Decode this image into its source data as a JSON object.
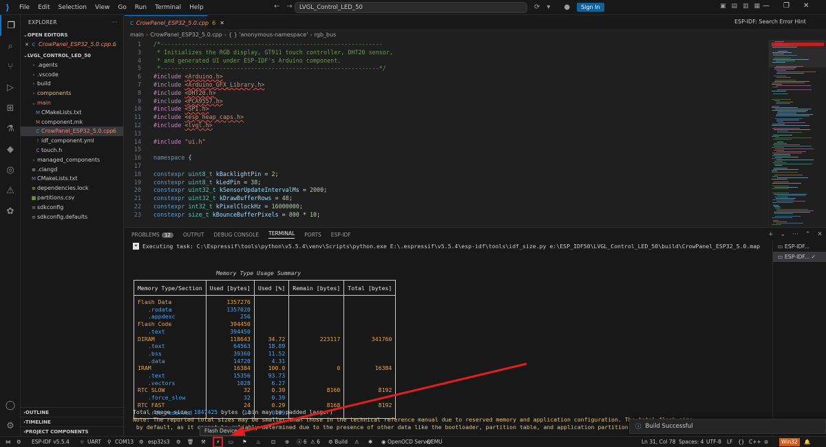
{
  "app": {
    "menu": [
      "File",
      "Edit",
      "Selection",
      "View",
      "Go",
      "Run",
      "Terminal",
      "Help"
    ],
    "search_text": "LVGL_Control_LED_50",
    "sign_in": "Sign In"
  },
  "sidebar": {
    "title": "EXPLORER",
    "open_editors_label": "OPEN EDITORS",
    "open_editor_file": "CrowPanel_ESP32_5.0.cpp...",
    "open_editor_badge": "6",
    "project_label": "LVGL_CONTROL_LED_50",
    "tree": [
      {
        "label": ".agents",
        "kind": "folder"
      },
      {
        "label": ".vscode",
        "kind": "folder"
      },
      {
        "label": "build",
        "kind": "folder"
      },
      {
        "label": "components",
        "kind": "folder"
      },
      {
        "label": "main",
        "kind": "folder-open"
      },
      {
        "label": "CMakeLists.txt",
        "kind": "file"
      },
      {
        "label": "component.mk",
        "kind": "file"
      },
      {
        "label": "CrowPanel_ESP32_5.0.cpp",
        "kind": "file",
        "badge": "6"
      },
      {
        "label": "idf_component.yml",
        "kind": "file"
      },
      {
        "label": "touch.h",
        "kind": "file"
      },
      {
        "label": "managed_components",
        "kind": "folder"
      },
      {
        "label": ".clangd",
        "kind": "file"
      },
      {
        "label": "CMakeLists.txt",
        "kind": "file"
      },
      {
        "label": "dependencies.lock",
        "kind": "file"
      },
      {
        "label": "partitions.csv",
        "kind": "file"
      },
      {
        "label": "sdkconfig",
        "kind": "file"
      },
      {
        "label": "sdkconfig.defaults",
        "kind": "file"
      }
    ],
    "bottom_sections": [
      "OUTLINE",
      "TIMELINE",
      "PROJECT COMPONENTS"
    ]
  },
  "editor": {
    "tab_label": "CrowPanel_ESP32_5.0.cpp",
    "tab_badge": "6",
    "hint": "ESP-IDF: Search Error Hint",
    "breadcrumb": [
      "main",
      "CrowPanel_ESP32_5.0.cpp",
      "{ } 'anonymous-namespace'",
      "rgb_bus"
    ],
    "lines": [
      {
        "n": "1",
        "t": "/*----------------------------------------------------------------"
      },
      {
        "n": "3",
        "t": " * Initializes the RGB display, GT911 touch controller, DHT20 sensor,"
      },
      {
        "n": "4",
        "t": " * and generated UI under ESP-IDF's Arduino component."
      },
      {
        "n": "5",
        "t": " *---------------------------------------------------------------*/"
      },
      {
        "n": "6",
        "t": "#include <Arduino.h>"
      },
      {
        "n": "7",
        "t": "#include <Arduino_GFX_Library.h>"
      },
      {
        "n": "8",
        "t": "#include <DHT20.h>"
      },
      {
        "n": "9",
        "t": "#include <PCA9557.h>"
      },
      {
        "n": "10",
        "t": "#include <SPI.h>"
      },
      {
        "n": "11",
        "t": "#include <esp_heap_caps.h>"
      },
      {
        "n": "12",
        "t": "#include <lvgl.h>"
      },
      {
        "n": "13",
        "t": ""
      },
      {
        "n": "14",
        "t": "#include \"ui.h\""
      },
      {
        "n": "15",
        "t": ""
      },
      {
        "n": "16",
        "t": "namespace {"
      },
      {
        "n": "17",
        "t": ""
      },
      {
        "n": "18",
        "t": "constexpr uint8_t kBacklightPin = 2;"
      },
      {
        "n": "19",
        "t": "constexpr uint8_t kLedPin = 38;"
      },
      {
        "n": "20",
        "t": "constexpr uint32_t kSensorUpdateIntervalMs = 2000;"
      },
      {
        "n": "21",
        "t": "constexpr uint32_t kDrawBufferRows = 48;"
      },
      {
        "n": "22",
        "t": "constexpr int32_t kPixelClockHz = 16000000;"
      },
      {
        "n": "23",
        "t": "constexpr size_t kBounceBufferPixels = 800 * 10;"
      }
    ]
  },
  "panel": {
    "tabs": [
      "PROBLEMS",
      "OUTPUT",
      "DEBUG CONSOLE",
      "TERMINAL",
      "PORTS",
      "ESP-IDF"
    ],
    "problems_count": "12",
    "task_line": "Executing task: C:\\Espressif\\tools\\python\\v5.5.4\\venv\\Scripts\\python.exe E:\\.espressif\\v5.5.4\\esp-idf\\tools\\idf_size.py e:\\ESP_IDF50\\LVGL_Control_LED_50\\build\\CrowPanel_ESP32_5.0.map",
    "table_title": "Memory Type Usage Summary",
    "table_headers": [
      "Memory Type/Section",
      "Used [bytes]",
      "Used [%]",
      "Remain [bytes]",
      "Total [bytes]"
    ],
    "table_rows": [
      {
        "name": "Flash Data",
        "used": "1357276",
        "pct": "",
        "remain": "",
        "total": "",
        "sub": false
      },
      {
        "name": ".rodata",
        "used": "1357020",
        "pct": "",
        "remain": "",
        "total": "",
        "sub": true
      },
      {
        "name": ".appdesc",
        "used": "256",
        "pct": "",
        "remain": "",
        "total": "",
        "sub": true
      },
      {
        "name": "Flash Code",
        "used": "394450",
        "pct": "",
        "remain": "",
        "total": "",
        "sub": false
      },
      {
        "name": ".text",
        "used": "394450",
        "pct": "",
        "remain": "",
        "total": "",
        "sub": true
      },
      {
        "name": "DIRAM",
        "used": "118643",
        "pct": "34.72",
        "remain": "223117",
        "total": "341760",
        "sub": false
      },
      {
        "name": ".text",
        "used": "64563",
        "pct": "18.89",
        "remain": "",
        "total": "",
        "sub": true
      },
      {
        "name": ".bss",
        "used": "39360",
        "pct": "11.52",
        "remain": "",
        "total": "",
        "sub": true
      },
      {
        "name": ".data",
        "used": "14720",
        "pct": "4.31",
        "remain": "",
        "total": "",
        "sub": true
      },
      {
        "name": "IRAM",
        "used": "16384",
        "pct": "100.0",
        "remain": "0",
        "total": "16384",
        "sub": false
      },
      {
        "name": ".text",
        "used": "15356",
        "pct": "93.73",
        "remain": "",
        "total": "",
        "sub": true
      },
      {
        "name": ".vectors",
        "used": "1028",
        "pct": "6.27",
        "remain": "",
        "total": "",
        "sub": true
      },
      {
        "name": "RTC SLOW",
        "used": "32",
        "pct": "0.39",
        "remain": "8160",
        "total": "8192",
        "sub": false
      },
      {
        "name": ".force_slow",
        "used": "32",
        "pct": "0.39",
        "remain": "",
        "total": "",
        "sub": true
      },
      {
        "name": "RTC FAST",
        "used": "24",
        "pct": "0.29",
        "remain": "8168",
        "total": "8192",
        "sub": false
      },
      {
        "name": ".rtc_reserved",
        "used": "24",
        "pct": "0.29",
        "remain": "",
        "total": "",
        "sub": true
      }
    ],
    "total_label": "Total image size: ",
    "total_value": "1847425",
    "total_suffix": " bytes (.bin may be padded larger)",
    "note1": "Note: The reported total sizes may be smaller than those in the technical reference manual due to reserved memory and application configuration. The total flash size",
    "note2": " by default, as it cannot be reliably determined due to the presence of other data like the bootloader, partition table, and application partition size.",
    "terminals": [
      "ESP-IDF...",
      "ESP-IDF..."
    ]
  },
  "toast": "Build Successful",
  "tooltip": "Flash Device",
  "status": {
    "idf": "ESP-IDF v5.5.4",
    "uart": "UART",
    "port": "COM13",
    "target": "esp32s3",
    "errors": "6",
    "warnings": "6",
    "build": "Build",
    "openocd": "OpenOCD Server",
    "qemu": "QEMU",
    "position": "Ln 31, Col 78",
    "spaces": "Spaces: 4",
    "encoding": "UTF-8",
    "eol": "LF",
    "lang": "C++",
    "platform": "Win32"
  },
  "colors": {
    "accent": "#0078d4",
    "flash_highlight": "#e31e1e",
    "orange": "#f0a040",
    "blue": "#4aa3f0"
  }
}
